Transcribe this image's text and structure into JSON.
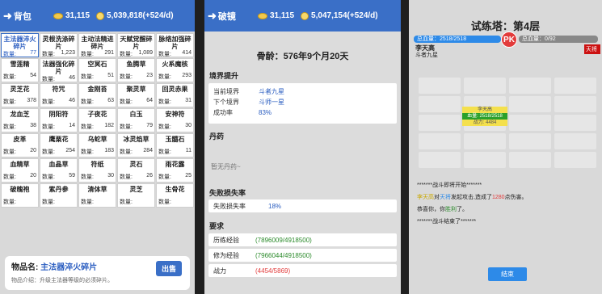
{
  "bag": {
    "back_label": "背包",
    "coins": "31,115",
    "gems": "5,039,818(+524/d)",
    "items": [
      {
        "name": "主法器淬火碎片",
        "qty_label": "数量:",
        "qty": "77",
        "selected": true
      },
      {
        "name": "灵根洗涤碎片",
        "qty_label": "数量:",
        "qty": "1,223"
      },
      {
        "name": "主动法精进碎片",
        "qty_label": "数量:",
        "qty": "291"
      },
      {
        "name": "天赋觉醒碎片",
        "qty_label": "数量:",
        "qty": "1,089"
      },
      {
        "name": "脉络加强碎片",
        "qty_label": "数量:",
        "qty": "414"
      },
      {
        "name": "雪莲精",
        "qty_label": "数量:",
        "qty": "54"
      },
      {
        "name": "法器强化碎片",
        "qty_label": "数量:",
        "qty": "46"
      },
      {
        "name": "空冥石",
        "qty_label": "数量:",
        "qty": "51"
      },
      {
        "name": "鱼腾草",
        "qty_label": "数量:",
        "qty": "23"
      },
      {
        "name": "火系魔核",
        "qty_label": "数量:",
        "qty": "293"
      },
      {
        "name": "灵芝花",
        "qty_label": "数量:",
        "qty": "378"
      },
      {
        "name": "符咒",
        "qty_label": "数量:",
        "qty": "46"
      },
      {
        "name": "金刚苔",
        "qty_label": "数量:",
        "qty": "63"
      },
      {
        "name": "聚灵草",
        "qty_label": "数量:",
        "qty": "64"
      },
      {
        "name": "回灵赤果",
        "qty_label": "数量:",
        "qty": "31"
      },
      {
        "name": "龙血芝",
        "qty_label": "数量:",
        "qty": "38"
      },
      {
        "name": "阴阳符",
        "qty_label": "数量:",
        "qty": "14"
      },
      {
        "name": "子夜花",
        "qty_label": "数量:",
        "qty": "182"
      },
      {
        "name": "白玉",
        "qty_label": "数量:",
        "qty": "79"
      },
      {
        "name": "安神符",
        "qty_label": "数量:",
        "qty": "30"
      },
      {
        "name": "皮革",
        "qty_label": "数量:",
        "qty": "20"
      },
      {
        "name": "鹰粟花",
        "qty_label": "数量:",
        "qty": "254"
      },
      {
        "name": "乌蛇草",
        "qty_label": "数量:",
        "qty": "183"
      },
      {
        "name": "冰灵焰草",
        "qty_label": "数量:",
        "qty": "284"
      },
      {
        "name": "玉髓石",
        "qty_label": "数量:",
        "qty": "11"
      },
      {
        "name": "血精草",
        "qty_label": "数量:",
        "qty": "20"
      },
      {
        "name": "血晶草",
        "qty_label": "数量:",
        "qty": "59"
      },
      {
        "name": "符纸",
        "qty_label": "数量:",
        "qty": "30"
      },
      {
        "name": "灵石",
        "qty_label": "数量:",
        "qty": "26"
      },
      {
        "name": "雨花露",
        "qty_label": "数量:",
        "qty": "25"
      },
      {
        "name": "破魄袍",
        "qty_label": "数量:",
        "qty": ""
      },
      {
        "name": "紫丹参",
        "qty_label": "数量:",
        "qty": ""
      },
      {
        "name": "清体草",
        "qty_label": "数量:",
        "qty": ""
      },
      {
        "name": "灵芝",
        "qty_label": "数量:",
        "qty": ""
      },
      {
        "name": "生骨花",
        "qty_label": "数量:",
        "qty": ""
      }
    ],
    "info": {
      "title_label": "物品名:",
      "title_value": "主法器淬火碎片",
      "desc": "物品介绍：升级主法器等级的必须碎片。",
      "sell_label": "出售"
    }
  },
  "breakthrough": {
    "back_label": "破镜",
    "coins": "31,115",
    "gems": "5,047,154(+524/d)",
    "age": "骨龄：576年9个月20天",
    "realm_title": "境界提升",
    "realm": [
      {
        "key": "当前境界",
        "value": "斗者九星"
      },
      {
        "key": "下个境界",
        "value": "斗师一星"
      },
      {
        "key": "成功率",
        "value": "83%"
      }
    ],
    "pill_title": "丹药",
    "pill_empty": "暂无丹药~",
    "fail_title": "失败损失率",
    "fail_key": "失败损失率",
    "fail_value": "18%",
    "req_title": "要求",
    "reqs": [
      {
        "key": "历练经验",
        "value": "(7896009/4918500)",
        "ok": true
      },
      {
        "key": "修为经验",
        "value": "(7966044/4918500)",
        "ok": true
      },
      {
        "key": "战力",
        "value": "(4454/5869)",
        "ok": false
      }
    ]
  },
  "tower": {
    "title": "试练塔：第4层",
    "left_hp": "总血量：2518/2518",
    "right_hp": "总血量：0/92",
    "left_name": "李天高",
    "left_sub": "斗者九星",
    "right_name": "天将",
    "pk": "PK",
    "cell_line1": "李天高",
    "cell_line2": "血量: 2518/2518",
    "cell_line3": "战力: 4484",
    "log": [
      "*******战斗即将开始*******",
      "李天高对天将发起攻击,造成了1280点伤害。",
      "恭喜你，你胜利了。",
      "*******战斗结束了*******"
    ],
    "end_label": "结束",
    "colors": {
      "accent": "#3a6fc7",
      "left_hp": "#2d8ae8",
      "right_hp": "#cc2222"
    }
  }
}
